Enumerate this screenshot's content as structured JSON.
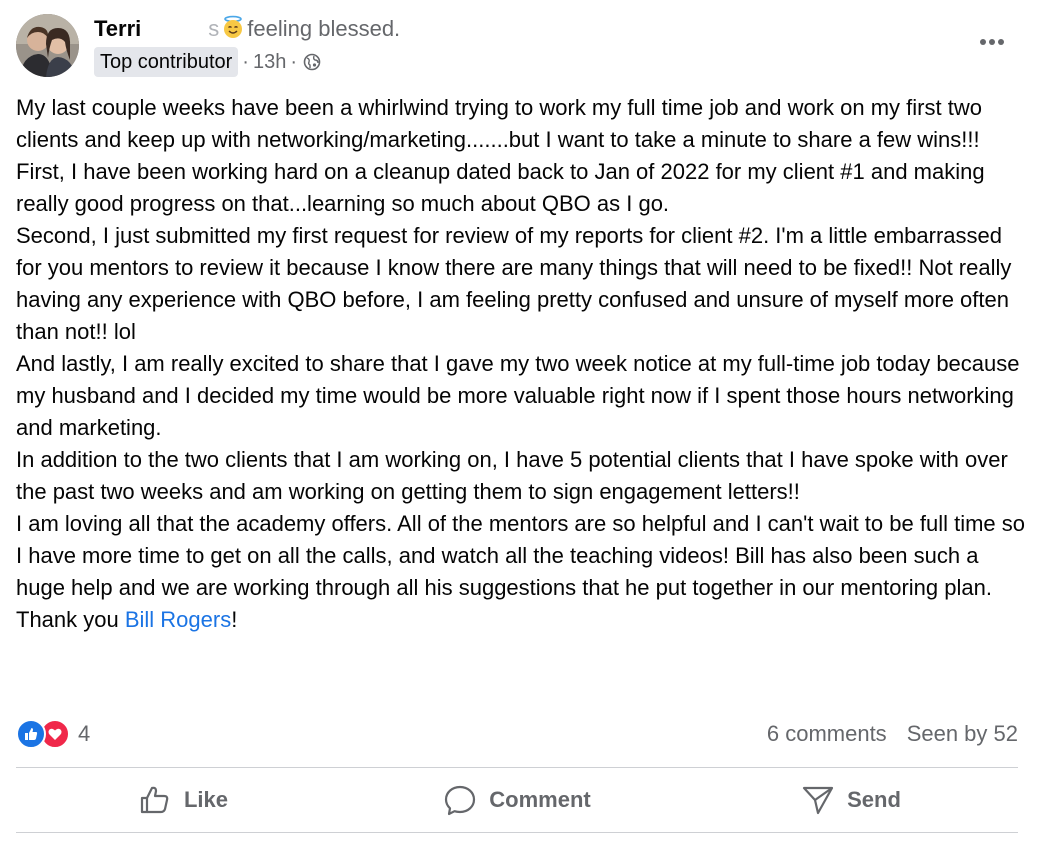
{
  "post": {
    "author": "Terri",
    "author_redacted_suffix": "s",
    "feeling_emoji": "smiling-face-with-halo",
    "feeling_text": "feeling blessed.",
    "badge": "Top contributor",
    "time": "13h",
    "meta_separator": "·",
    "audience_icon": "globe-icon",
    "more_icon": "more-dots-icon",
    "paragraphs": [
      "My last couple weeks have been a whirlwind trying to work my full time job and work on my first two clients and keep up with networking/marketing.......but I want to take a minute to share a few wins!!!",
      "First, I have been working hard on a cleanup dated back to Jan of 2022 for my client #1 and making really good progress on that...learning so much about QBO as I go.",
      "Second, I just submitted my first request for review of my reports for client #2.  I'm a little embarrassed for you mentors to review it because I know there are many things that will need to be fixed!!  Not really having any experience with QBO before, I am feeling pretty confused and unsure of myself more often than not!! lol",
      "And lastly, I am really excited to share that I gave my two week notice at my full-time job today because my husband and I decided my time would be more valuable right now if I spent those hours networking and marketing.",
      "In addition to the two clients that I am working on, I have 5 potential clients that I have spoke with over the past two weeks and am working on getting them to sign engagement letters!!"
    ],
    "last_paragraph": {
      "text": "I am loving all that the academy offers.  All of the mentors are so helpful and I can't wait to be full time so I have more time to get on all the calls, and watch all the teaching videos!  Bill has also been such a huge help and we are working through all his suggestions that he put together in our mentoring plan.  Thank you ",
      "mention": "Bill Rogers",
      "after": "!"
    }
  },
  "reactions": {
    "icons": [
      "like-reaction-icon",
      "love-reaction-icon"
    ],
    "count": "4"
  },
  "stats": {
    "comments": "6 comments",
    "seen": "Seen by 52"
  },
  "actions": {
    "like": "Like",
    "comment": "Comment",
    "send": "Send"
  },
  "colors": {
    "accent": "#1b74e4",
    "love": "#f0284a",
    "secondary_text": "#65676b",
    "badge_bg": "#e4e6eb",
    "divider": "#ced0d4"
  }
}
